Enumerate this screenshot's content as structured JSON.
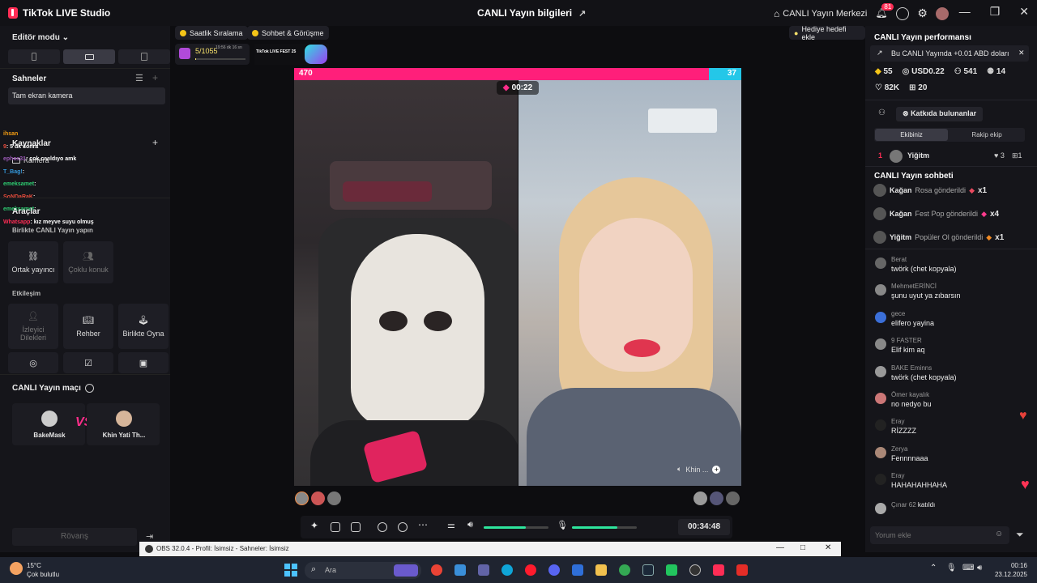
{
  "titlebar": {
    "app_name": "TikTok LIVE Studio",
    "center_title": "CANLI Yayın bilgileri",
    "live_center": "CANLI Yayın Merkezi",
    "notif_count": "81"
  },
  "left": {
    "editor_mode": "Editör modu",
    "scenes_title": "Sahneler",
    "scene_item": "Tam ekran kamera",
    "sources_title": "Kaynaklar",
    "source_camera": "Kamera",
    "tools_title": "Araçlar",
    "together_title": "Birlikte CANLI Yayın yapın",
    "tool_cohost": "Ortak yayıncı",
    "tool_multiguest": "Çoklu konuk",
    "interaction_title": "Etkileşim",
    "tool_viewer_requests": "İzleyici\nDilekleri",
    "tool_guide": "Rehber",
    "tool_play_together": "Birlikte Oyna",
    "match_title": "CANLI Yayın maçı",
    "player1": "BakeMask",
    "player2": "Khin Yati Th...",
    "vs": "VS",
    "rematch": "Rövanş",
    "overlay_chat": [
      {
        "name": "ihsan",
        "text": "",
        "color": "#f39c12"
      },
      {
        "name": "9",
        "text": ": 5 dk sonra",
        "color": "#e74c3c"
      },
      {
        "name": "ephas31",
        "text": ": çok cıvıldıyo amk",
        "color": "#9b59b6"
      },
      {
        "name": "T_Bag!",
        "text": ":",
        "color": "#3498db"
      },
      {
        "name": "emeksamet",
        "text": ":",
        "color": "#2ecc71"
      },
      {
        "name": "SoNDaRaK",
        "text": ":",
        "color": "#e74c3c"
      },
      {
        "name": "emeksamet",
        "text": ":",
        "color": "#2ecc71"
      },
      {
        "name": "Whatsapp",
        "text": ": kız meyve suyu olmuş",
        "color": "#ff2d55"
      }
    ]
  },
  "center": {
    "pill_hourly": "Saatlik Sıralama",
    "pill_chat": "Sohbet & Görüşme",
    "gift_goal": "Hediye hedefi ekle",
    "progress_text": "5/1055",
    "progress_fraction": 0.005,
    "progress_subtext": "19:56 dk 16 sn",
    "livefest_label": "TikTok LIVE FEST 25",
    "score_left": "470",
    "score_right": "37",
    "timer": "00:22",
    "right_video_label": "Khin ...",
    "duration": "00:34:48",
    "speaker_level": 0.65,
    "mic_level": 0.7
  },
  "right": {
    "perf_title": "CANLI Yayın performansı",
    "perf_note": "Bu CANLI Yayında +0.01 ABD doları",
    "stat_coins": "55",
    "stat_usd": "USD0.22",
    "stat_viewers": "541",
    "stat_new": "14",
    "stat_likes": "82K",
    "stat_gifts": "20",
    "contributors_btn": "Katkıda bulunanlar",
    "tab_our_team": "Ekibiniz",
    "tab_rival_team": "Rakip ekip",
    "contributor_rank": "1",
    "contributor_name": "Yiğitm",
    "contributor_likes": "3",
    "contributor_gifts": "1",
    "chat_title": "CANLI Yayın sohbeti",
    "gifts": [
      {
        "name": "Kağan",
        "text": "Rosa gönderildi",
        "count": "x1"
      },
      {
        "name": "Kağan",
        "text": "Fest Pop gönderildi",
        "count": "x4"
      },
      {
        "name": "Yiğitm",
        "text": "Popüler Ol gönderildi",
        "count": "x1"
      }
    ],
    "messages": [
      {
        "name": "Berat",
        "text": "twörk (chet kopyala)"
      },
      {
        "name": "MehmetERİNCİ",
        "text": "şunu uyut ya zıbarsın"
      },
      {
        "name": "gece",
        "text": "elifero yayina"
      },
      {
        "name": "9 FASTER",
        "text": "Elif kim aq"
      },
      {
        "name": "BAKE Eminns",
        "text": "twörk (chet kopyala)"
      },
      {
        "name": "Ömer kayalık",
        "text": "no nedyo bu"
      },
      {
        "name": "Eray",
        "text": "RİZZZZ"
      },
      {
        "name": "Zerya",
        "text": "Fennnnaaa"
      },
      {
        "name": "Eray",
        "text": "HAHAHAHHAHA"
      }
    ],
    "joined_name": "Çınar 62",
    "joined_text": "katıldı",
    "comment_placeholder": "Yorum ekle"
  },
  "obs": {
    "title": "OBS 32.0.4 - Profil: İsimsiz - Sahneler: İsimsiz"
  },
  "taskbar": {
    "temp": "15°C",
    "weather": "Çok bulutlu",
    "search_placeholder": "Ara",
    "time": "00:16",
    "date": "23.12.2025"
  },
  "colors": {
    "accent_pink": "#ff1f7a",
    "accent_blue": "#24c7e8",
    "level_green": "#2ee59d"
  }
}
